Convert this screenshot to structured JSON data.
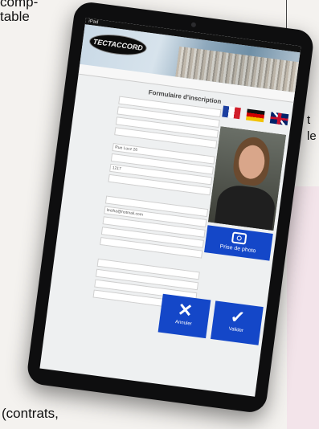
{
  "document": {
    "top_left_text": "comp-\ntable",
    "right_text": "t\nle",
    "bottom_text": "(contrats,"
  },
  "tablet": {
    "status_left": "iPad",
    "status_center": "",
    "status_right": "",
    "logo": "TECTACCORD",
    "url": "",
    "form_title": "Formulaire d'inscription",
    "fields": [
      {
        "label": "",
        "value": ""
      },
      {
        "label": "",
        "value": ""
      },
      {
        "label": "",
        "value": ""
      },
      {
        "label": "",
        "value": ""
      },
      {
        "label": "",
        "value": "Rue Lucz 26"
      },
      {
        "label": "",
        "value": ""
      },
      {
        "label": "",
        "value": "1217"
      },
      {
        "label": "",
        "value": ""
      },
      {
        "label": "",
        "value": ""
      },
      {
        "label": "",
        "value": "lectha@hotmail.com"
      },
      {
        "label": "",
        "value": ""
      },
      {
        "label": "",
        "value": ""
      },
      {
        "label": "",
        "value": ""
      },
      {
        "label": "",
        "value": ""
      },
      {
        "label": "",
        "value": ""
      },
      {
        "label": "",
        "value": ""
      },
      {
        "label": "",
        "value": ""
      }
    ],
    "photo_button_label": "Prise de photo",
    "cancel_label": "Annuler",
    "validate_label": "Valider",
    "accent_color": "#1447c8"
  }
}
